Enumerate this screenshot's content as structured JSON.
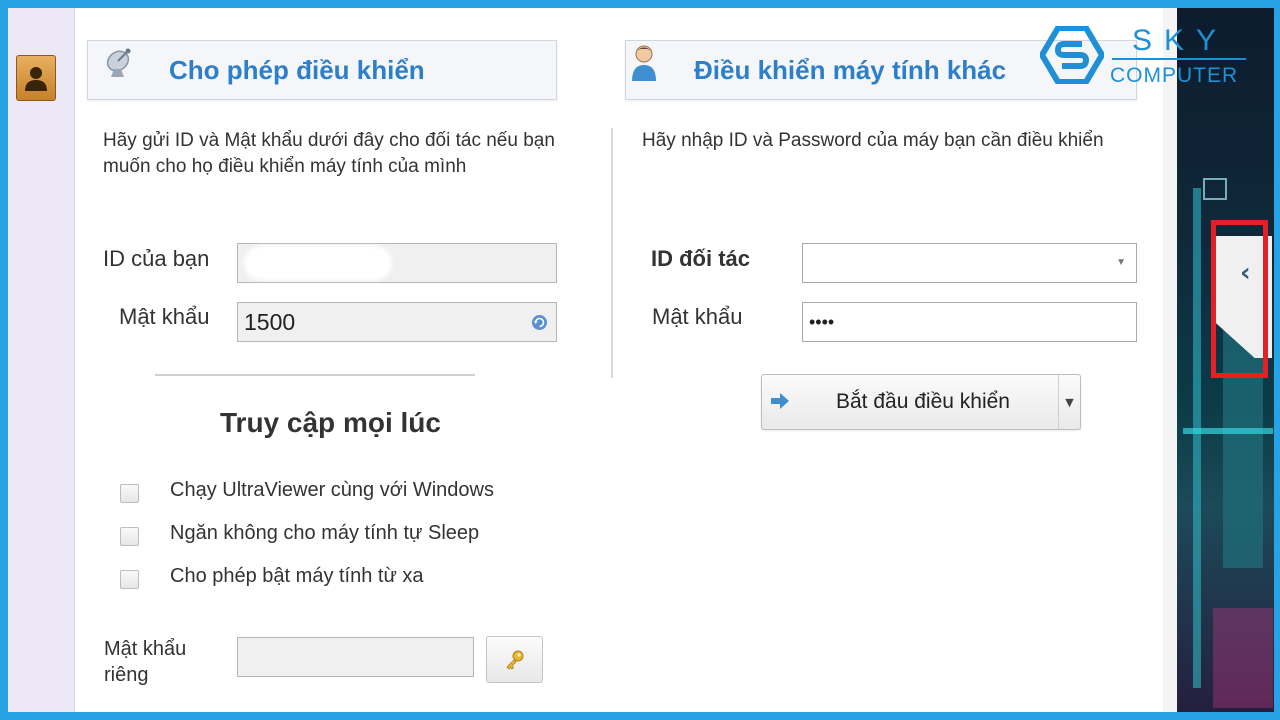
{
  "logo": {
    "line1": "SKY",
    "line2": "COMPUTER"
  },
  "allow_control": {
    "title": "Cho phép điều khiển",
    "description": "Hãy gửi ID và Mật khẩu dưới đây cho đối tác nếu bạn muốn cho họ điều khiển máy tính của mình",
    "id_label": "ID của bạn",
    "id_value": "",
    "password_label": "Mật khẩu",
    "password_value": "1500"
  },
  "unattended": {
    "heading": "Truy cập mọi lúc",
    "options": [
      {
        "label": "Chạy UltraViewer cùng với Windows",
        "checked": false
      },
      {
        "label": "Ngăn không cho máy tính tự Sleep",
        "checked": false
      },
      {
        "label": "Cho phép bật máy tính từ xa",
        "checked": false
      }
    ],
    "private_password_label_line1": "Mật khẩu",
    "private_password_label_line2": "riêng",
    "private_password_value": ""
  },
  "remote_control": {
    "title": "Điều khiển máy tính khác",
    "description": "Hãy nhập ID và Password của máy bạn cần điều khiển",
    "partner_id_label": "ID đối tác",
    "partner_id_value": "",
    "password_label": "Mật khẩu",
    "password_value": "••••",
    "start_button": "Bắt đầu điều khiển"
  },
  "colors": {
    "frame": "#27a2e4",
    "title_blue": "#2e7fc9",
    "highlight_red": "#e51f26"
  }
}
